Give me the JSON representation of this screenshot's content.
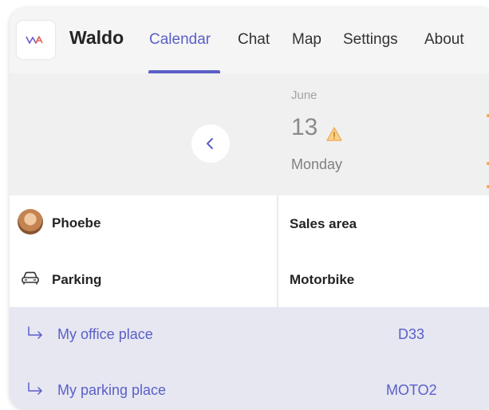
{
  "app": {
    "name": "Waldo",
    "logo_text": "WA"
  },
  "nav": {
    "tabs": [
      {
        "label": "Calendar",
        "active": true
      },
      {
        "label": "Chat",
        "active": false
      },
      {
        "label": "Map",
        "active": false
      },
      {
        "label": "Settings",
        "active": false
      },
      {
        "label": "About",
        "active": false
      }
    ]
  },
  "date": {
    "month": "June",
    "day": "13",
    "weekday": "Monday",
    "status_icon": "warning-icon",
    "prev_icon": "chevron-left-icon"
  },
  "rows": [
    {
      "label": "Phoebe",
      "icon": "avatar",
      "value": "Sales area"
    },
    {
      "label": "Parking",
      "icon": "car-icon",
      "value": "Motorbike"
    }
  ],
  "places": [
    {
      "label": "My office place",
      "code": "D33"
    },
    {
      "label": "My parking place",
      "code": "MOTO2"
    }
  ],
  "colors": {
    "accent": "#5b5fc7",
    "warning": "#f2a44a",
    "places_bg": "#e6e7f1"
  }
}
